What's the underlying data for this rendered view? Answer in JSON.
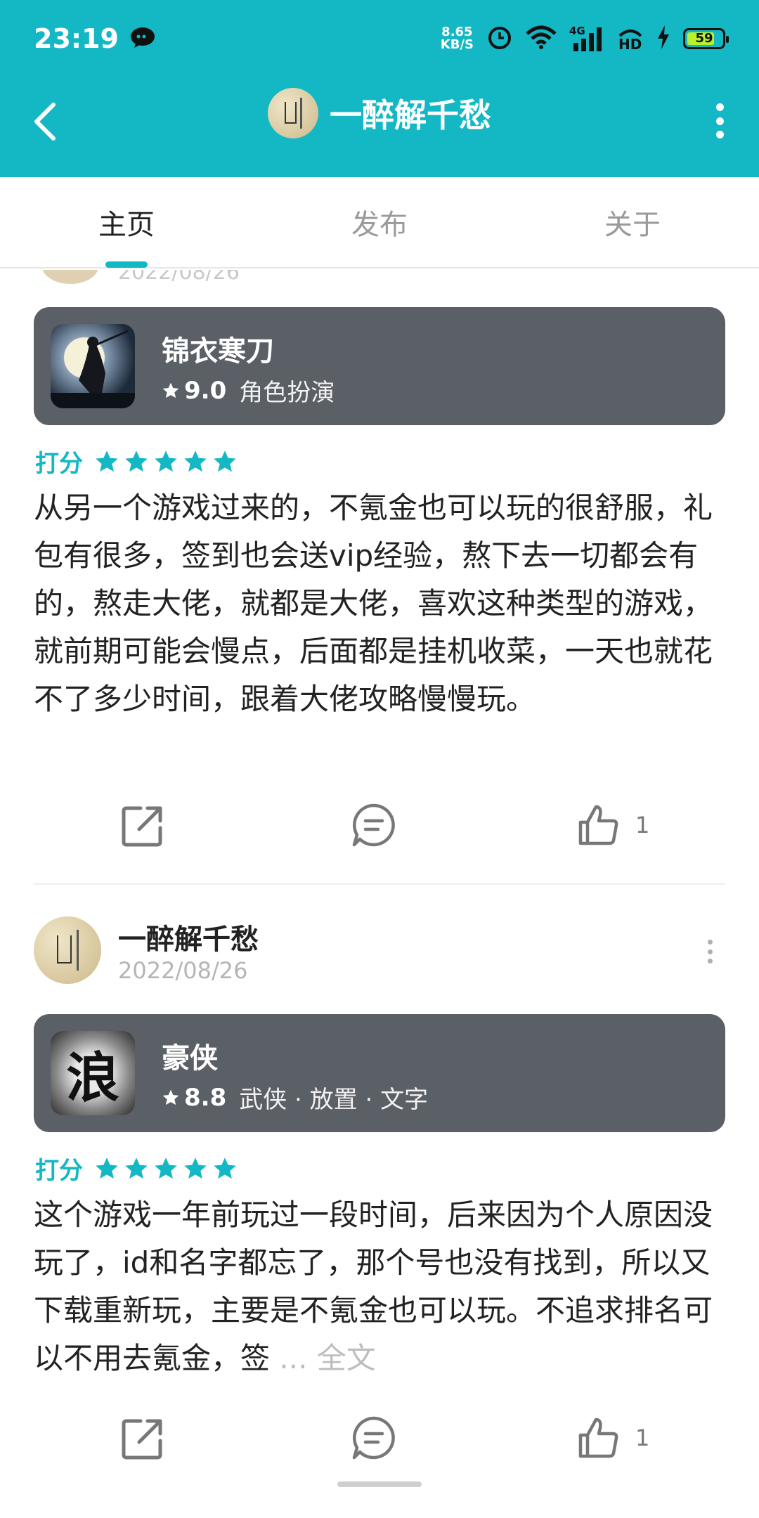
{
  "status_bar": {
    "time": "23:19",
    "net_speed_value": "8.65",
    "net_speed_unit": "KB/S",
    "signal_label": "4G",
    "hd_label": "HD",
    "battery": "59"
  },
  "header": {
    "title": "一醉解千愁"
  },
  "tabs": [
    {
      "label": "主页"
    },
    {
      "label": "发布"
    },
    {
      "label": "关于"
    }
  ],
  "partial_post": {
    "date": "2022/08/26"
  },
  "posts": [
    {
      "game": {
        "name": "锦衣寒刀",
        "score": "9.0",
        "tags": "角色扮演"
      },
      "rating_label": "打分",
      "stars": 5,
      "review": "从另一个游戏过来的，不氪金也可以玩的很舒服，礼包有很多，签到也会送vip经验，熬下去一切都会有的，熬走大佬，就都是大佬，喜欢这种类型的游戏，就前期可能会慢点，后面都是挂机收菜，一天也就花不了多少时间，跟着大佬攻略慢慢玩。",
      "likes": "1"
    },
    {
      "author": "一醉解千愁",
      "date": "2022/08/26",
      "game": {
        "name": "豪侠",
        "score": "8.8",
        "tags": "武侠 · 放置 · 文字",
        "icon_char": "浪"
      },
      "rating_label": "打分",
      "stars": 5,
      "review": "这个游戏一年前玩过一段时间，后来因为个人原因没玩了，id和名字都忘了，那个号也没有找到，所以又下载重新玩，主要是不氪金也可以玩。不追求排名可以不用去氪金，签",
      "ellipsis": "...",
      "full_text": "全文",
      "likes": "1"
    }
  ],
  "colors": {
    "accent": "#13b8c4",
    "card_bg": "#5b5f66"
  }
}
